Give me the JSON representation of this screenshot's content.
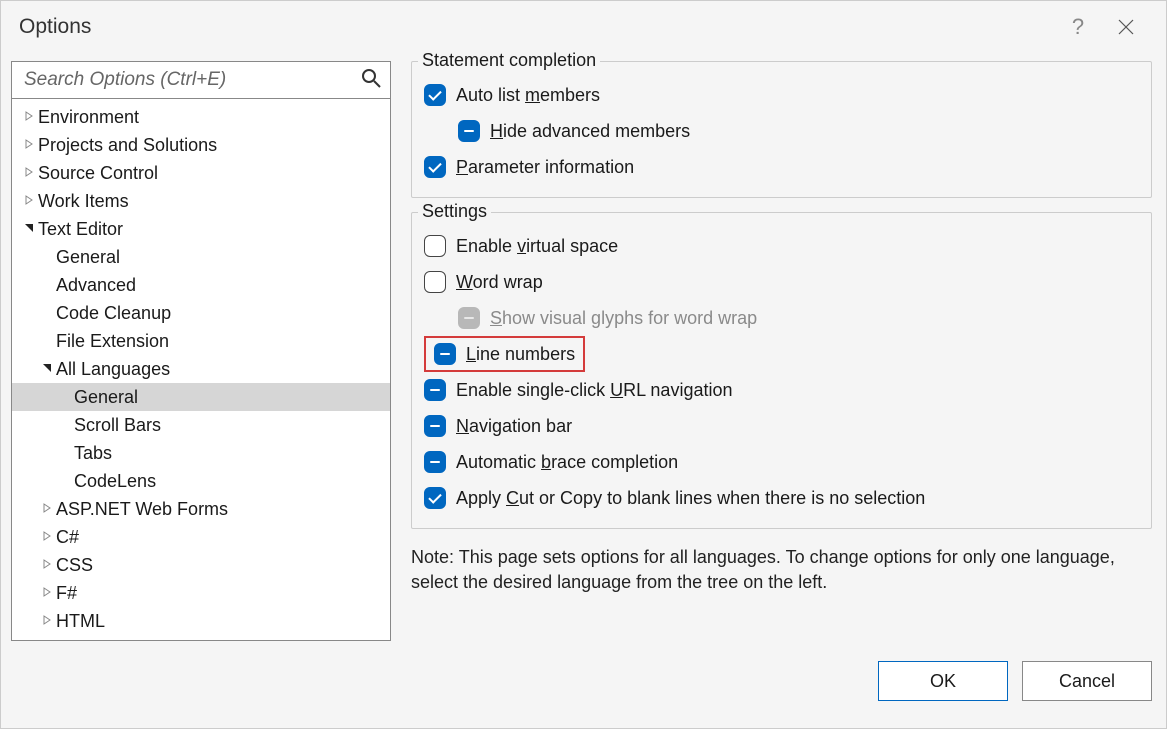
{
  "window": {
    "title": "Options"
  },
  "search": {
    "placeholder": "Search Options (Ctrl+E)"
  },
  "tree": [
    {
      "label": "Environment",
      "indent": 0,
      "tri": "closed"
    },
    {
      "label": "Projects and Solutions",
      "indent": 0,
      "tri": "closed"
    },
    {
      "label": "Source Control",
      "indent": 0,
      "tri": "closed"
    },
    {
      "label": "Work Items",
      "indent": 0,
      "tri": "closed"
    },
    {
      "label": "Text Editor",
      "indent": 0,
      "tri": "open"
    },
    {
      "label": "General",
      "indent": 1,
      "tri": "none"
    },
    {
      "label": "Advanced",
      "indent": 1,
      "tri": "none"
    },
    {
      "label": "Code Cleanup",
      "indent": 1,
      "tri": "none"
    },
    {
      "label": "File Extension",
      "indent": 1,
      "tri": "none"
    },
    {
      "label": "All Languages",
      "indent": 1,
      "tri": "open"
    },
    {
      "label": "General",
      "indent": 2,
      "tri": "none",
      "selected": true
    },
    {
      "label": "Scroll Bars",
      "indent": 2,
      "tri": "none"
    },
    {
      "label": "Tabs",
      "indent": 2,
      "tri": "none"
    },
    {
      "label": "CodeLens",
      "indent": 2,
      "tri": "none"
    },
    {
      "label": "ASP.NET Web Forms",
      "indent": 1,
      "tri": "closed"
    },
    {
      "label": "C#",
      "indent": 1,
      "tri": "closed"
    },
    {
      "label": "CSS",
      "indent": 1,
      "tri": "closed"
    },
    {
      "label": "F#",
      "indent": 1,
      "tri": "closed"
    },
    {
      "label": "HTML",
      "indent": 1,
      "tri": "closed"
    }
  ],
  "groups": {
    "statement": {
      "title": "Statement completion",
      "opts": {
        "autolist": {
          "pre": "Auto list ",
          "ul": "m",
          "post": "embers",
          "state": "checked"
        },
        "hideadv": {
          "pre": "",
          "ul": "H",
          "post": "ide advanced members",
          "state": "indet",
          "sub": true
        },
        "paraminfo": {
          "pre": "",
          "ul": "P",
          "post": "arameter information",
          "state": "checked"
        }
      }
    },
    "settings": {
      "title": "Settings",
      "opts": {
        "virtspace": {
          "pre": "Enable ",
          "ul": "v",
          "post": "irtual space",
          "state": "empty"
        },
        "wordwrap": {
          "pre": "",
          "ul": "W",
          "post": "ord wrap",
          "state": "empty"
        },
        "glyphs": {
          "pre": "",
          "ul": "S",
          "post": "how visual glyphs for word wrap",
          "state": "disabled",
          "sub": true
        },
        "linenum": {
          "pre": "",
          "ul": "L",
          "post": "ine numbers",
          "state": "indet",
          "highlight": true
        },
        "urlnav": {
          "pre": "Enable single-click ",
          "ul": "U",
          "post": "RL navigation",
          "state": "indet"
        },
        "navbar": {
          "pre": "",
          "ul": "N",
          "post": "avigation bar",
          "state": "indet"
        },
        "brace": {
          "pre": "Automatic ",
          "ul": "b",
          "post": "race completion",
          "state": "indet"
        },
        "cutcopy": {
          "pre": "Apply ",
          "ul": "C",
          "post": "ut or Copy to blank lines when there is no selection",
          "state": "checked"
        }
      }
    }
  },
  "note": "Note: This page sets options for all languages. To change options for only one language, select the desired language from the tree on the left.",
  "buttons": {
    "ok": "OK",
    "cancel": "Cancel"
  }
}
